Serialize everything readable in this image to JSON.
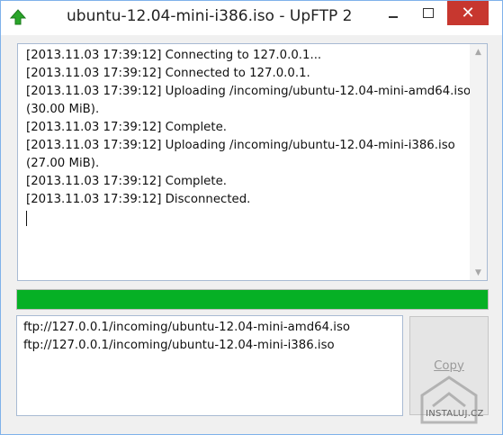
{
  "window": {
    "title": "ubuntu-12.04-mini-i386.iso - UpFTP 2",
    "app_icon": "green-up-arrow-icon",
    "controls": {
      "minimize": "minimize-icon",
      "maximize": "maximize-icon",
      "close": "close-icon",
      "close_glyph": "✕"
    }
  },
  "log": {
    "lines": [
      "[2013.11.03 17:39:12] Connecting to 127.0.0.1...",
      "[2013.11.03 17:39:12] Connected to 127.0.0.1.",
      "[2013.11.03 17:39:12] Uploading /incoming/ubuntu-12.04-mini-amd64.iso",
      "(30.00 MiB).",
      "[2013.11.03 17:39:12] Complete.",
      "[2013.11.03 17:39:12] Uploading /incoming/ubuntu-12.04-mini-i386.iso",
      "(27.00 MiB).",
      "[2013.11.03 17:39:12] Complete.",
      "[2013.11.03 17:39:12] Disconnected."
    ],
    "scroll_up_glyph": "▲",
    "scroll_down_glyph": "▼"
  },
  "progress": {
    "value": 1.0,
    "color": "#06b025"
  },
  "urls": {
    "lines": [
      "ftp://127.0.0.1/incoming/ubuntu-12.04-mini-amd64.iso",
      "ftp://127.0.0.1/incoming/ubuntu-12.04-mini-i386.iso"
    ]
  },
  "copy_button": {
    "label": "Copy"
  },
  "watermark": {
    "text": "INSTALUJ.CZ"
  }
}
